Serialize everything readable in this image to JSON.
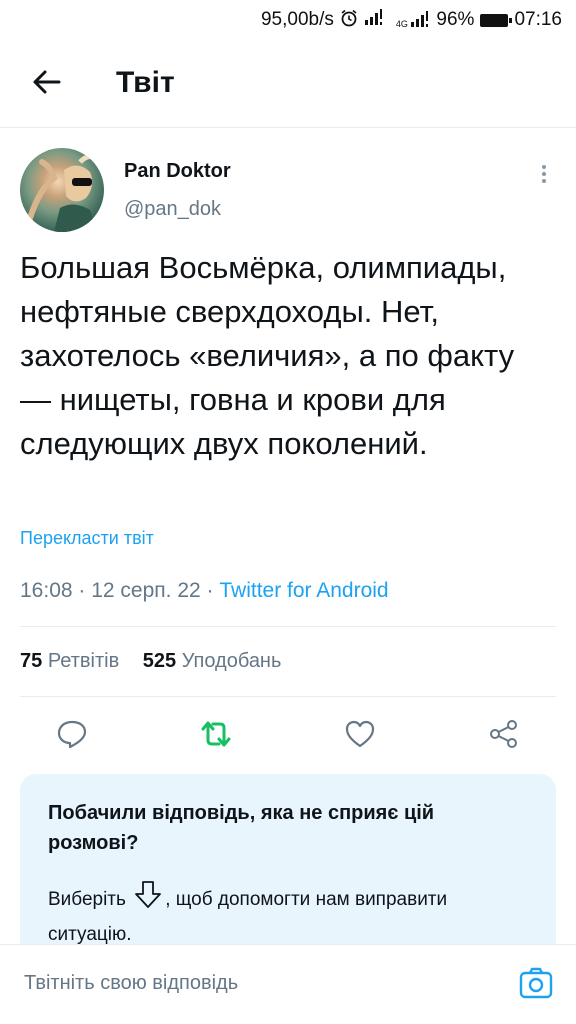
{
  "status_bar": {
    "speed": "95,00b/s",
    "network": "4G",
    "battery": "96%",
    "time": "07:16",
    "icons": [
      "alarm-icon",
      "signal-icon",
      "signal-4g-icon",
      "battery-icon"
    ]
  },
  "header": {
    "title": "Твіт",
    "back_icon": "arrow-left-icon"
  },
  "tweet": {
    "author_name": "Pan Doktor",
    "author_handle": "@pan_dok",
    "text": "Большая Восьмёрка, олимпиады, нефтяные сверхдоходы. Нет, захотелось «величия», а по факту — нищеты, говна и крови для следующих двух поколений.",
    "translate_label": "Перекласти твіт",
    "time": "16:08",
    "date": "12 серп. 22",
    "source": "Twitter for Android",
    "retweets_count": "75",
    "retweets_label": "Ретвітів",
    "likes_count": "525",
    "likes_label": "Уподобань"
  },
  "actions": {
    "reply_icon": "comment-icon",
    "retweet_icon": "retweet-icon",
    "like_icon": "heart-icon",
    "share_icon": "share-icon",
    "retweet_color": "#17bf63"
  },
  "notice": {
    "title": "Побачили відповідь, яка не сприяє цій розмові?",
    "text_before": "Виберіть",
    "text_after": ", щоб допомогти нам виправити ситуацію."
  },
  "composer": {
    "placeholder": "Твітніть свою відповідь",
    "camera_icon": "camera-icon"
  },
  "colors": {
    "accent": "#1da1f2",
    "secondary_text": "#657786",
    "notice_bg": "#e8f5fd"
  }
}
